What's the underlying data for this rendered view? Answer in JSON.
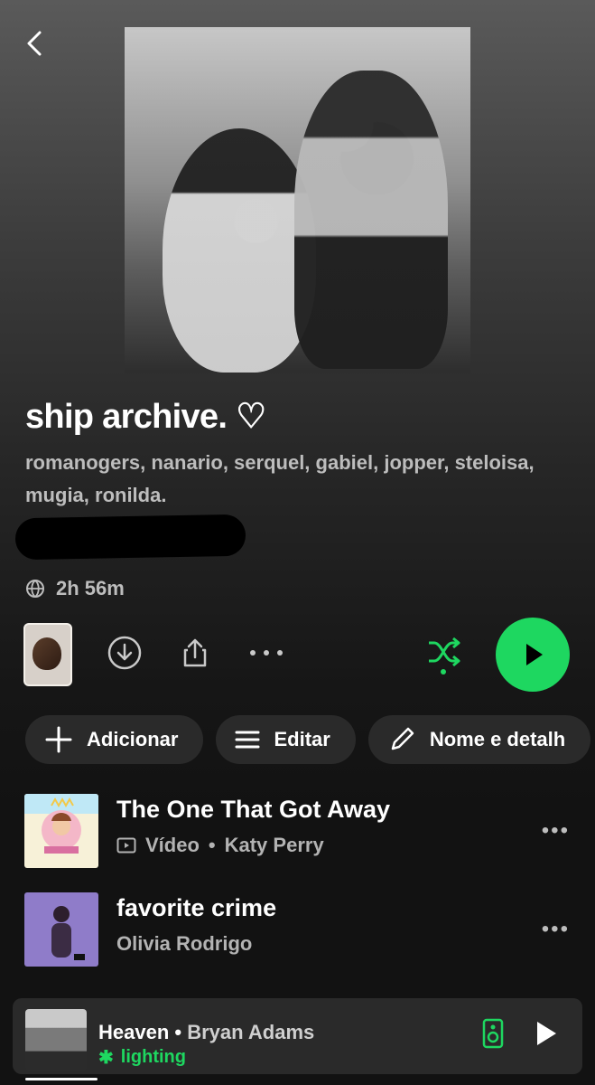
{
  "playlist": {
    "title": "ship archive. ♡",
    "description": "romanogers, nanario, serquel, gabiel, jopper, steloisa, mugia, ronilda.",
    "duration": "2h 56m"
  },
  "actions": {
    "add": "Adicionar",
    "edit": "Editar",
    "name_details": "Nome e detalh"
  },
  "tracks": [
    {
      "title": "The One That Got Away",
      "type": "Vídeo",
      "artist": "Katy Perry"
    },
    {
      "title": "favorite crime",
      "artist": "Olivia Rodrigo"
    }
  ],
  "now_playing": {
    "title": "Heaven",
    "artist": "Bryan Adams",
    "device": "lighting"
  },
  "colors": {
    "accent": "#1ed760"
  }
}
